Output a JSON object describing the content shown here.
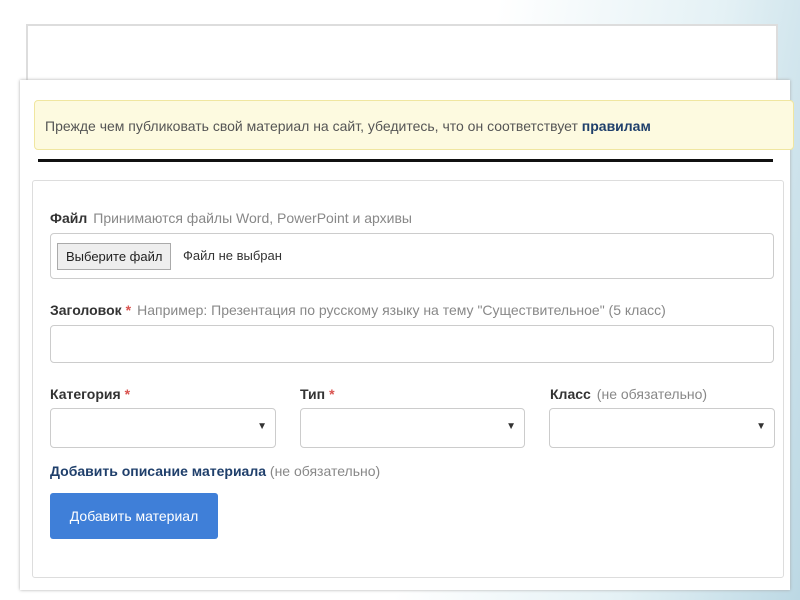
{
  "notice": {
    "text": "Прежде чем публиковать свой материал на сайт, убедитесь, что он соответствует ",
    "link": "правилам"
  },
  "file": {
    "label": "Файл",
    "hint": "Принимаются файлы Word, PowerPoint и архивы",
    "button": "Выберите файл",
    "status": "Файл не выбран"
  },
  "title": {
    "label": "Заголовок",
    "required": "*",
    "hint": "Например: Презентация по русскому языку на тему \"Существительное\" (5 класс)",
    "value": ""
  },
  "category": {
    "label": "Категория",
    "required": "*"
  },
  "type": {
    "label": "Тип",
    "required": "*"
  },
  "grade": {
    "label": "Класс",
    "hint": "(не обязательно)"
  },
  "description": {
    "link": "Добавить описание материала",
    "hint": "(не обязательно)"
  },
  "submit": "Добавить материал",
  "arrow": "▼"
}
